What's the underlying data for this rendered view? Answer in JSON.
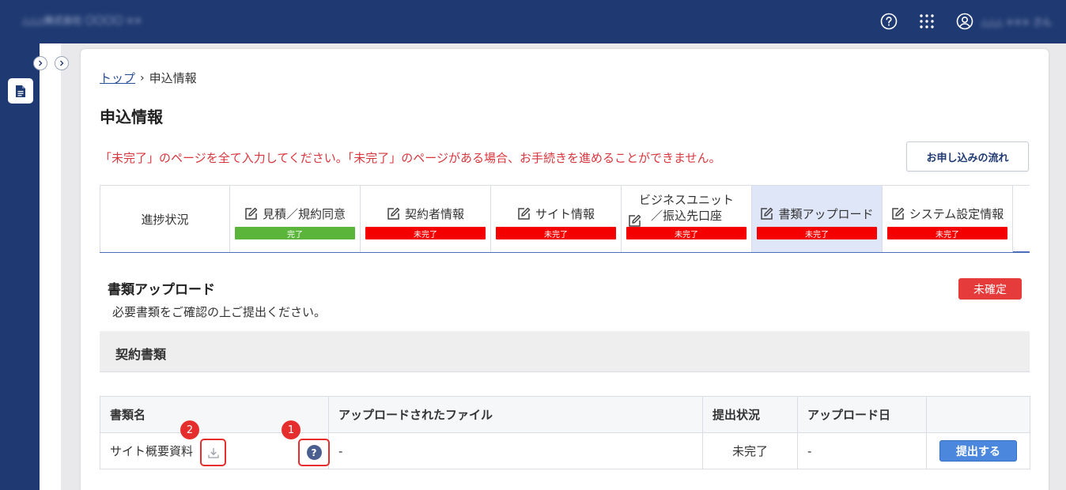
{
  "header": {
    "app_title": "△△△株式会社 〇〇〇〇 ××",
    "user_name": "△△△ ××× さん",
    "help_icon": "question-circle-icon",
    "apps_icon": "grid-dots-icon",
    "user_icon": "user-circle-icon"
  },
  "sidebar": {
    "doc_icon": "document-icon"
  },
  "breadcrumb": {
    "top": "トップ",
    "separator": "›",
    "current": "申込情報"
  },
  "page": {
    "title": "申込情報",
    "warning": "「未完了」のページを全て入力してください。「未完了」のページがある場合、お手続きを進めることができません。",
    "flow_button": "お申し込みの流れ"
  },
  "steps": {
    "header": "進捗状況",
    "items": [
      {
        "label": "見積／規約同意",
        "status": "完了"
      },
      {
        "label": "契約者情報",
        "status": "未完了"
      },
      {
        "label": "サイト情報",
        "status": "未完了"
      },
      {
        "label_line1": "ビジネスユニット",
        "label_line2": "／振込先口座",
        "status": "未完了"
      },
      {
        "label": "書類アップロード",
        "status": "未完了"
      },
      {
        "label": "システム設定情報",
        "status": "未完了"
      }
    ]
  },
  "section": {
    "title": "書類アップロード",
    "description": "必要書類をご確認の上ご提出ください。",
    "status": "未確定"
  },
  "group": {
    "title": "契約書類"
  },
  "table": {
    "headers": [
      "書類名",
      "アップロードされたファイル",
      "提出状況",
      "アップロード日",
      ""
    ],
    "rows": [
      {
        "name": "サイト概要資料",
        "file": "-",
        "status": "未完了",
        "date": "-",
        "action": "提出する"
      }
    ]
  },
  "annotations": {
    "download": "2",
    "help": "1",
    "help_mark": "?"
  },
  "colors": {
    "navy": "#1f3a72",
    "red": "#f40000",
    "green": "#5bb53b",
    "blue": "#4b87dd"
  }
}
